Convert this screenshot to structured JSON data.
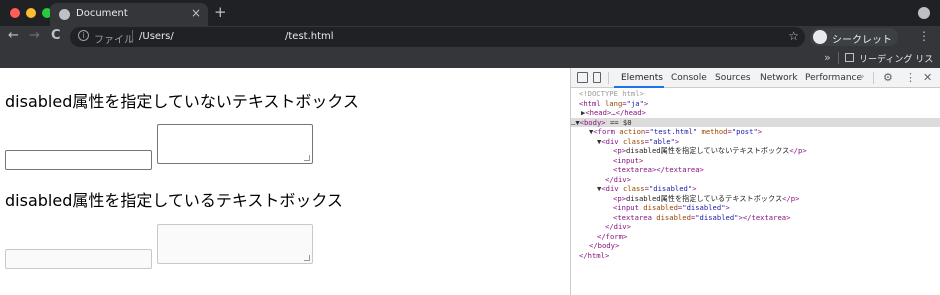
{
  "browser": {
    "tab_title": "Document",
    "tab_close": "×",
    "new_tab": "+",
    "nav": {
      "back": "←",
      "forward": "→",
      "reload": "C"
    },
    "omnibox": {
      "scheme_label": "ファイル",
      "path_part1": "/Users/",
      "path_part2": "/test.html",
      "star": "☆"
    },
    "incognito_label": "シークレット",
    "menu": "⋮",
    "bookmarks": {
      "chevron": "»",
      "reading_list": "リーディング リスト"
    }
  },
  "page": {
    "able_heading": "disabled属性を指定していないテキストボックス",
    "disabled_heading": "disabled属性を指定しているテキストボックス"
  },
  "devtools": {
    "tabs": [
      "Elements",
      "Console",
      "Sources",
      "Network",
      "Performance"
    ],
    "more": "»",
    "gear": "⚙",
    "kebab": "⋮",
    "close": "✕",
    "dom": {
      "doctype": "<!DOCTYPE html>",
      "html_open": "<html",
      "html_attr": "lang",
      "html_val": "\"ja\"",
      "head_collapsed": "<head>…</head>",
      "body_open": "<body>",
      "body_eq": "== $0",
      "form_open": "<form",
      "form_action_attr": "action",
      "form_action_val": "\"test.html\"",
      "form_method_attr": "method",
      "form_method_val": "\"post\"",
      "div_open": "<div",
      "class_attr": "class",
      "able_val": "\"able\"",
      "p_open": "<p>",
      "p_close": "</p>",
      "input_tag": "<input>",
      "textarea_open": "<textarea>",
      "textarea_close": "</textarea>",
      "div_close": "</div>",
      "disabled_val": "\"disabled\"",
      "input_open": "<input",
      "disabled_attr": "disabled",
      "textarea_open_tag": "<textarea",
      "form_close": "</form>",
      "body_close": "</body>",
      "html_close": "</html>",
      "ellipsis": "…"
    }
  },
  "colors": {
    "chrome_bg": "#202124",
    "toolbar_bg": "#35363a",
    "tab_underline": "#1a73e8"
  }
}
